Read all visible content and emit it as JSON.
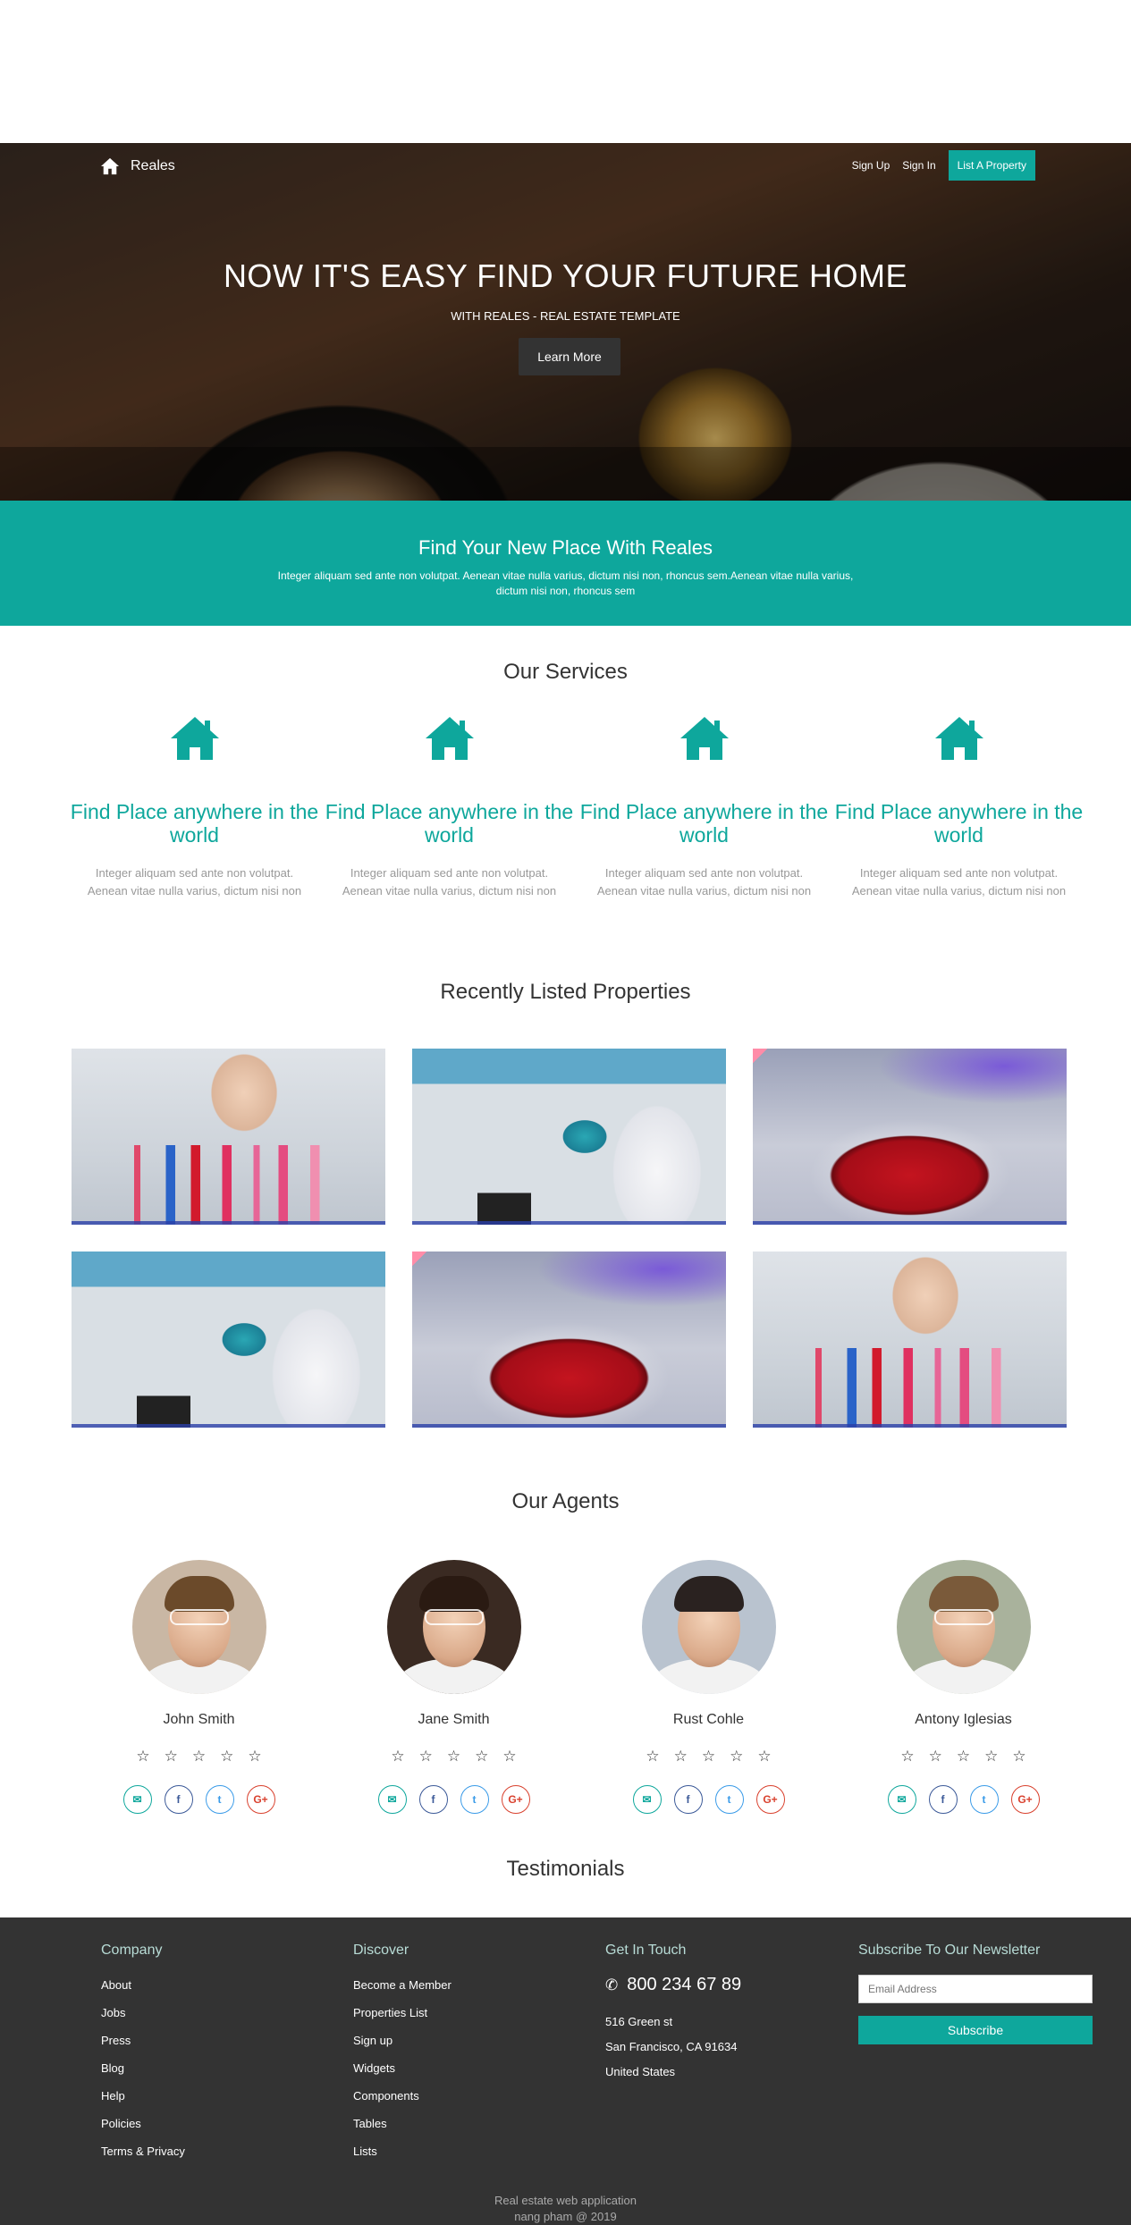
{
  "header": {
    "brand": "Reales",
    "nav": {
      "sign_up": "Sign Up",
      "sign_in": "Sign In",
      "list_property": "List A Property"
    }
  },
  "hero": {
    "title": "NOW IT'S EASY FIND YOUR FUTURE HOME",
    "subtitle": "WITH REALES - REAL ESTATE TEMPLATE",
    "button": "Learn More"
  },
  "band": {
    "title": "Find Your New Place With Reales",
    "text": "Integer aliquam sed ante non volutpat. Aenean vitae nulla varius, dictum nisi non, rhoncus sem.Aenean vitae nulla varius, dictum nisi non, rhoncus sem"
  },
  "services": {
    "title": "Our Services",
    "items": [
      {
        "icon": "house-icon",
        "heading": "Find Place anywhere in the world",
        "text": "Integer aliquam sed ante non volutpat. Aenean vitae nulla varius, dictum nisi non"
      },
      {
        "icon": "house-icon",
        "heading": "Find Place anywhere in the world",
        "text": "Integer aliquam sed ante non volutpat. Aenean vitae nulla varius, dictum nisi non"
      },
      {
        "icon": "house-icon",
        "heading": "Find Place anywhere in the world",
        "text": "Integer aliquam sed ante non volutpat. Aenean vitae nulla varius, dictum nisi non"
      },
      {
        "icon": "house-icon",
        "heading": "Find Place anywhere in the world",
        "text": "Integer aliquam sed ante non volutpat. Aenean vitae nulla varius, dictum nisi non"
      }
    ]
  },
  "properties": {
    "title": "Recently Listed Properties"
  },
  "agents": {
    "title": "Our Agents",
    "items": [
      {
        "name": "John Smith",
        "rating": 0
      },
      {
        "name": "Jane Smith",
        "rating": 0
      },
      {
        "name": "Rust Cohle",
        "rating": 0
      },
      {
        "name": "Antony Iglesias",
        "rating": 0
      }
    ],
    "star_glyph": "☆"
  },
  "testimonials": {
    "title": "Testimonials"
  },
  "footer": {
    "company": {
      "title": "Company",
      "links": [
        "About",
        "Jobs",
        "Press",
        "Blog",
        "Help",
        "Policies",
        "Terms & Privacy"
      ]
    },
    "discover": {
      "title": "Discover",
      "links": [
        "Become a Member",
        "Properties List",
        "Sign up",
        "Widgets",
        "Components",
        "Tables",
        "Lists"
      ]
    },
    "contact": {
      "title": "Get In Touch",
      "phone": "800 234 67 89",
      "address_line1": "516 Green st",
      "address_line2": "San Francisco, CA 91634",
      "country": "United States"
    },
    "newsletter": {
      "title": "Subscribe To Our Newsletter",
      "placeholder": "Email Address",
      "button": "Subscribe"
    },
    "copyright_line1": "Real estate web application",
    "copyright_line2": "nang pham @ 2019"
  },
  "colors": {
    "accent": "#0ea79c",
    "footer_bg": "#333333"
  }
}
